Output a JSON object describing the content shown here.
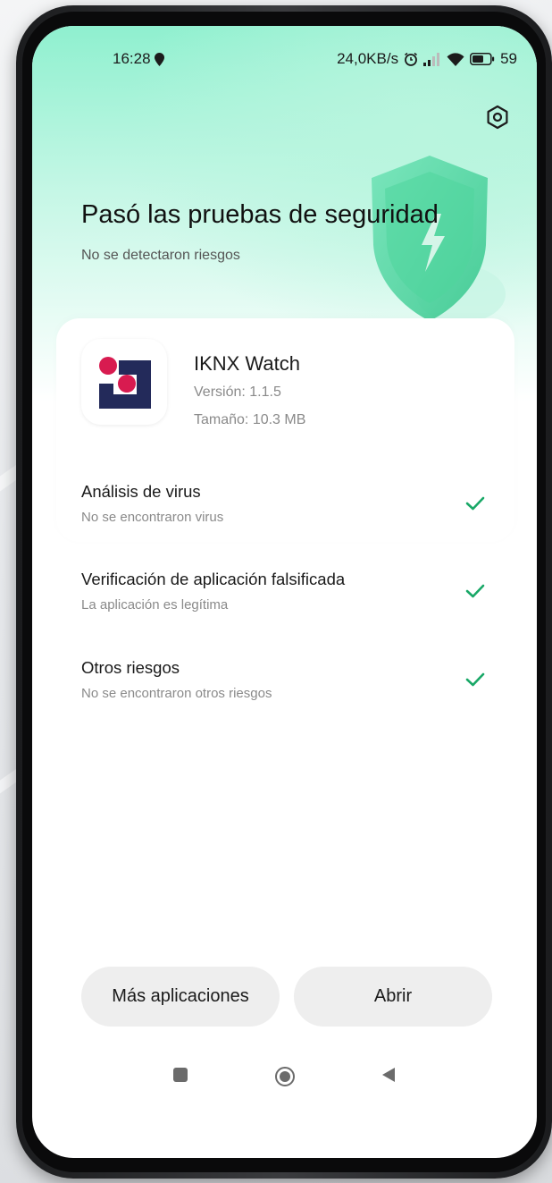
{
  "status_bar": {
    "time": "16:28",
    "network_speed": "24,0KB/s",
    "battery": "59",
    "icons": [
      "location-icon",
      "alarm-icon",
      "signal-icon",
      "wifi-icon",
      "battery-icon"
    ]
  },
  "header": {
    "title": "Pasó las pruebas de seguridad",
    "subtitle": "No se detectaron riesgos",
    "settings_icon": "gear-icon"
  },
  "app": {
    "name": "IKNX Watch",
    "version": "Versión: 1.1.5",
    "size": "Tamaño: 10.3 MB"
  },
  "checks": [
    {
      "title": "Análisis de virus",
      "subtitle": "No se encontraron virus",
      "status": "passed"
    },
    {
      "title": "Verificación de aplicación falsificada",
      "subtitle": "La aplicación es legítima",
      "status": "passed"
    },
    {
      "title": "Otros riesgos",
      "subtitle": "No se encontraron otros riesgos",
      "status": "passed"
    }
  ],
  "buttons": {
    "more_apps": "Más aplicaciones",
    "open": "Abrir"
  },
  "nav_bar": [
    "recents-icon",
    "home-icon",
    "back-icon"
  ],
  "colors": {
    "accent_green": "#19a867",
    "hero_mint": "#8ff0cf",
    "logo_pink": "#d81b50",
    "logo_navy": "#232a5a",
    "button_bg": "#eeeeee"
  }
}
